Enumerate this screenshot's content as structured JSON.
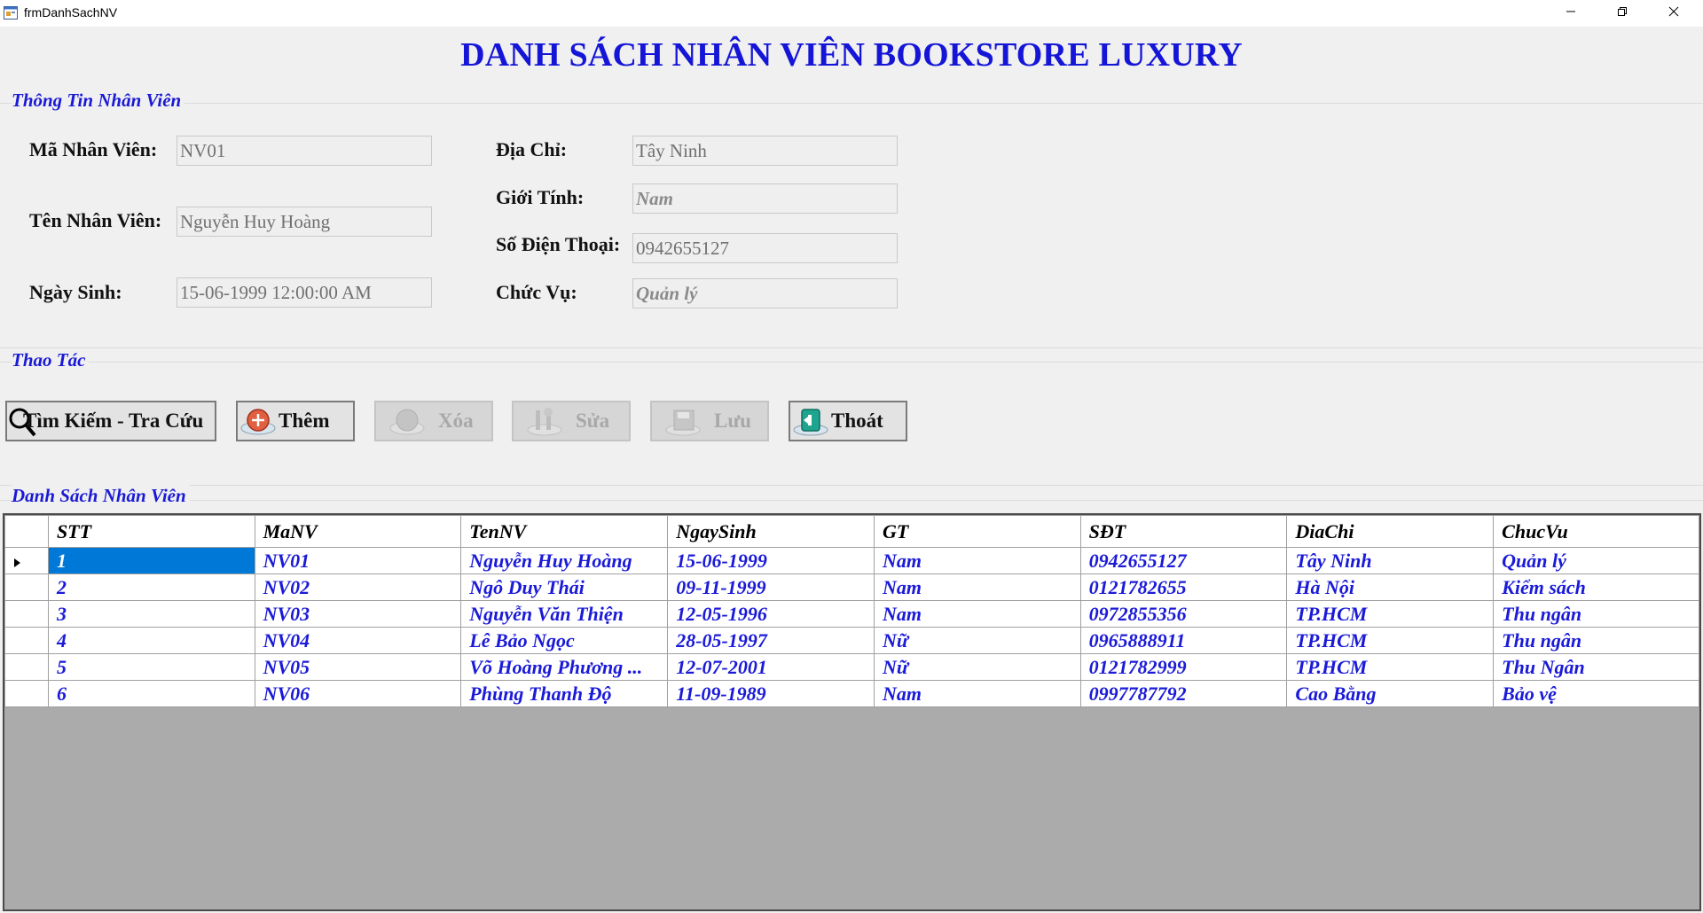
{
  "window": {
    "title": "frmDanhSachNV",
    "controls": {
      "minimize": "minimize-icon",
      "restore": "restore-icon",
      "close": "close-icon"
    }
  },
  "heading": "DANH SÁCH NHÂN VIÊN BOOKSTORE LUXURY",
  "info_group": {
    "title": "Thông Tin Nhân Viên",
    "ma_nv": {
      "label": "Mã Nhân Viên:",
      "value": "NV01"
    },
    "ten_nv": {
      "label": "Tên Nhân Viên:",
      "value": "Nguyễn Huy Hoàng"
    },
    "ngay_sinh": {
      "label": "Ngày Sinh:",
      "value": "15-06-1999 12:00:00 AM"
    },
    "dia_chi": {
      "label": "Địa Chỉ:",
      "value": "Tây Ninh"
    },
    "gioi_tinh": {
      "label": "Giới Tính:",
      "value": "Nam"
    },
    "so_dien_thoai": {
      "label": "Số Điện Thoại:",
      "value": "0942655127"
    },
    "chuc_vu": {
      "label": "Chức Vụ:",
      "value": "Quản lý"
    }
  },
  "actions_group": {
    "title": "Thao Tác",
    "search": {
      "label": "Tìm Kiếm - Tra Cứu",
      "enabled": true
    },
    "add": {
      "label": "Thêm",
      "enabled": true
    },
    "delete": {
      "label": "Xóa",
      "enabled": false
    },
    "edit": {
      "label": "Sửa",
      "enabled": false
    },
    "save": {
      "label": "Lưu",
      "enabled": false
    },
    "exit": {
      "label": "Thoát",
      "enabled": true
    }
  },
  "list_group": {
    "title": "Danh Sách Nhân Viên",
    "columns": [
      "STT",
      "MaNV",
      "TenNV",
      "NgaySinh",
      "GT",
      "SĐT",
      "DiaChi",
      "ChucVu"
    ],
    "rows": [
      [
        "1",
        "NV01",
        "Nguyễn Huy Hoàng",
        "15-06-1999",
        "Nam",
        "0942655127",
        "Tây Ninh",
        "Quản lý"
      ],
      [
        "2",
        "NV02",
        "Ngô Duy Thái",
        "09-11-1999",
        "Nam",
        "0121782655",
        "Hà Nội",
        "Kiểm sách"
      ],
      [
        "3",
        "NV03",
        "Nguyễn Văn Thiện",
        "12-05-1996",
        "Nam",
        "0972855356",
        "TP.HCM",
        "Thu ngân"
      ],
      [
        "4",
        "NV04",
        "Lê Bảo Ngọc",
        "28-05-1997",
        "Nữ",
        "0965888911",
        "TP.HCM",
        "Thu ngân"
      ],
      [
        "5",
        "NV05",
        "Võ Hoàng Phương ...",
        "12-07-2001",
        "Nữ",
        "0121782999",
        "TP.HCM",
        "Thu Ngân"
      ],
      [
        "6",
        "NV06",
        "Phùng Thanh Độ",
        "11-09-1989",
        "Nam",
        "0997787792",
        "Cao Bằng",
        "Bảo vệ"
      ]
    ],
    "selected_row": 0
  }
}
